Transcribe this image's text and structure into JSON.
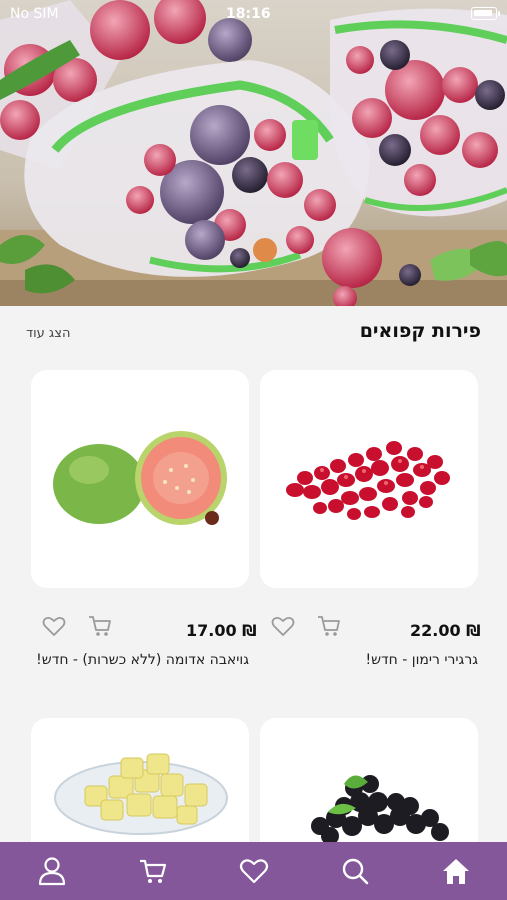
{
  "status_bar": {
    "carrier": "No SIM",
    "time": "18:16"
  },
  "section": {
    "title": "פירות קפואים",
    "show_more": "הצג עוד"
  },
  "products": [
    {
      "name": "גרגירי רימון - חדש!",
      "price": "₪ 22.00"
    },
    {
      "name": "גויאבה אדומה (ללא כשרות) - חדש!",
      "price": "₪ 17.00"
    }
  ],
  "nav": {
    "items": [
      "home-icon",
      "search-icon",
      "heart-icon",
      "cart-icon",
      "user-icon"
    ]
  },
  "colors": {
    "nav_bg": "#83579a",
    "icon_gray": "#9a9a9a",
    "page_bg": "#f3f3f3"
  }
}
